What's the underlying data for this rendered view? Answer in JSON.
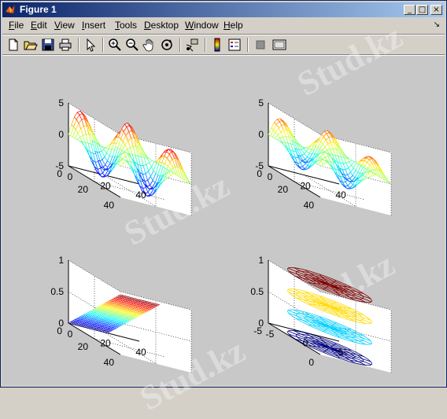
{
  "window": {
    "title": "Figure 1"
  },
  "window_buttons": {
    "minimize": "_",
    "maximize": "□",
    "close": "×"
  },
  "menu": {
    "items": [
      {
        "label": "File",
        "u": "F",
        "rest": "ile"
      },
      {
        "label": "Edit",
        "u": "E",
        "rest": "dit"
      },
      {
        "label": "View",
        "u": "V",
        "rest": "iew"
      },
      {
        "label": "Insert",
        "u": "I",
        "rest": "nsert"
      },
      {
        "label": "Tools",
        "u": "T",
        "rest": "ools"
      },
      {
        "label": "Desktop",
        "u": "D",
        "rest": "esktop"
      },
      {
        "label": "Window",
        "u": "W",
        "rest": "indow"
      },
      {
        "label": "Help",
        "u": "H",
        "rest": "elp"
      }
    ],
    "dock_glyph": "↘"
  },
  "toolbar": {
    "icons": [
      "new-file-icon",
      "open-folder-icon",
      "save-icon",
      "print-icon",
      "pointer-arrow-icon",
      "zoom-in-icon",
      "zoom-out-icon",
      "pan-hand-icon",
      "rotate-3d-icon",
      "data-cursor-icon",
      "colorbar-icon",
      "legend-icon",
      "hide-plot-tools-icon",
      "show-plot-tools-icon"
    ]
  },
  "watermark": {
    "text": "Stud.kz"
  },
  "plots": [
    {
      "name": "plot-top-left",
      "z_ticks": [
        "5",
        "0",
        "-5"
      ],
      "y_ticks": [
        "40",
        "20",
        "0"
      ],
      "x_ticks": [
        "0",
        "20",
        "40"
      ],
      "surface": "peaks-mesh"
    },
    {
      "name": "plot-top-right",
      "z_ticks": [
        "5",
        "0",
        "-5"
      ],
      "y_ticks": [
        "40",
        "20",
        "0"
      ],
      "x_ticks": [
        "0",
        "20",
        "40"
      ],
      "surface": "peaks-mesh-flat"
    },
    {
      "name": "plot-bottom-left",
      "z_ticks": [
        "1",
        "0.5",
        "0"
      ],
      "y_ticks": [
        "40",
        "20",
        "0"
      ],
      "x_ticks": [
        "0",
        "20",
        "40"
      ],
      "surface": "sloped-plane"
    },
    {
      "name": "plot-bottom-right",
      "z_ticks": [
        "1",
        "0.5",
        "0"
      ],
      "y_ticks": [
        "0",
        "-5"
      ],
      "x_ticks": [
        "-5",
        "0",
        "5"
      ],
      "surface": "stacked-disks"
    }
  ],
  "colors": {
    "title_start": "#0a246a",
    "title_end": "#a6caf0",
    "canvas": "#c8c8c8"
  }
}
